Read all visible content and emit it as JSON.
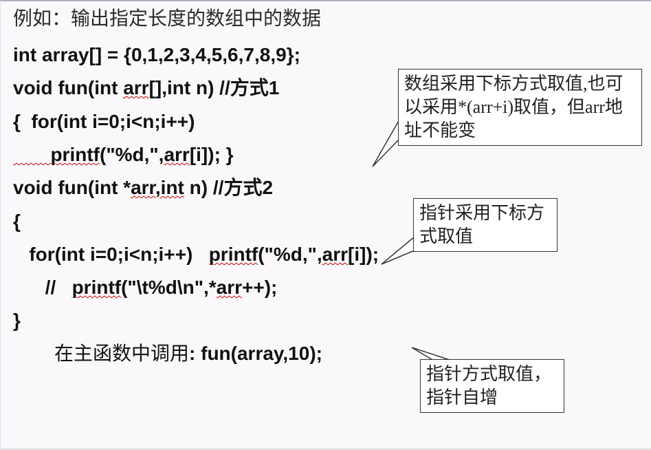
{
  "intro": "例如：输出指定长度的数组中的数据",
  "code": {
    "l1": "int array[] = {0,1,2,3,4,5,6,7,8,9};",
    "l2a": "void fun(int ",
    "l2b": "arr",
    "l2c": "[],int n) //",
    "l2d": "方式",
    "l2e": "1",
    "l3": "{  for(int i=0;i<n;i++)",
    "l4a": "       printf",
    "l4b": "(\"%d,\",",
    "l4c": "arr",
    "l4d": "[i]); }",
    "l5a": "void fun(int *",
    "l5b": "arr,int",
    "l5c": " n) //",
    "l5d": "方式",
    "l5e": "2",
    "l6": "{",
    "l7a": "   for(int i=0;i<n;i++)   ",
    "l7b": "printf",
    "l7c": "(\"%d,\",",
    "l7d": "arr",
    "l7e": "[i]);",
    "l8a": "      //   ",
    "l8b": "printf",
    "l8c": "(\"\\t%d\\n\",*",
    "l8d": "arr",
    "l8e": "++);",
    "l9": "}"
  },
  "footer": {
    "cn": "在主函数中调用",
    "bold": ": fun(array,10);"
  },
  "callouts": {
    "c1": "数组采用下标方式取值,也可以采用*(arr+i)取值，但arr地址不能变",
    "c2": "指针采用下标方式取值",
    "c3": "指针方式取值，指针自增"
  }
}
